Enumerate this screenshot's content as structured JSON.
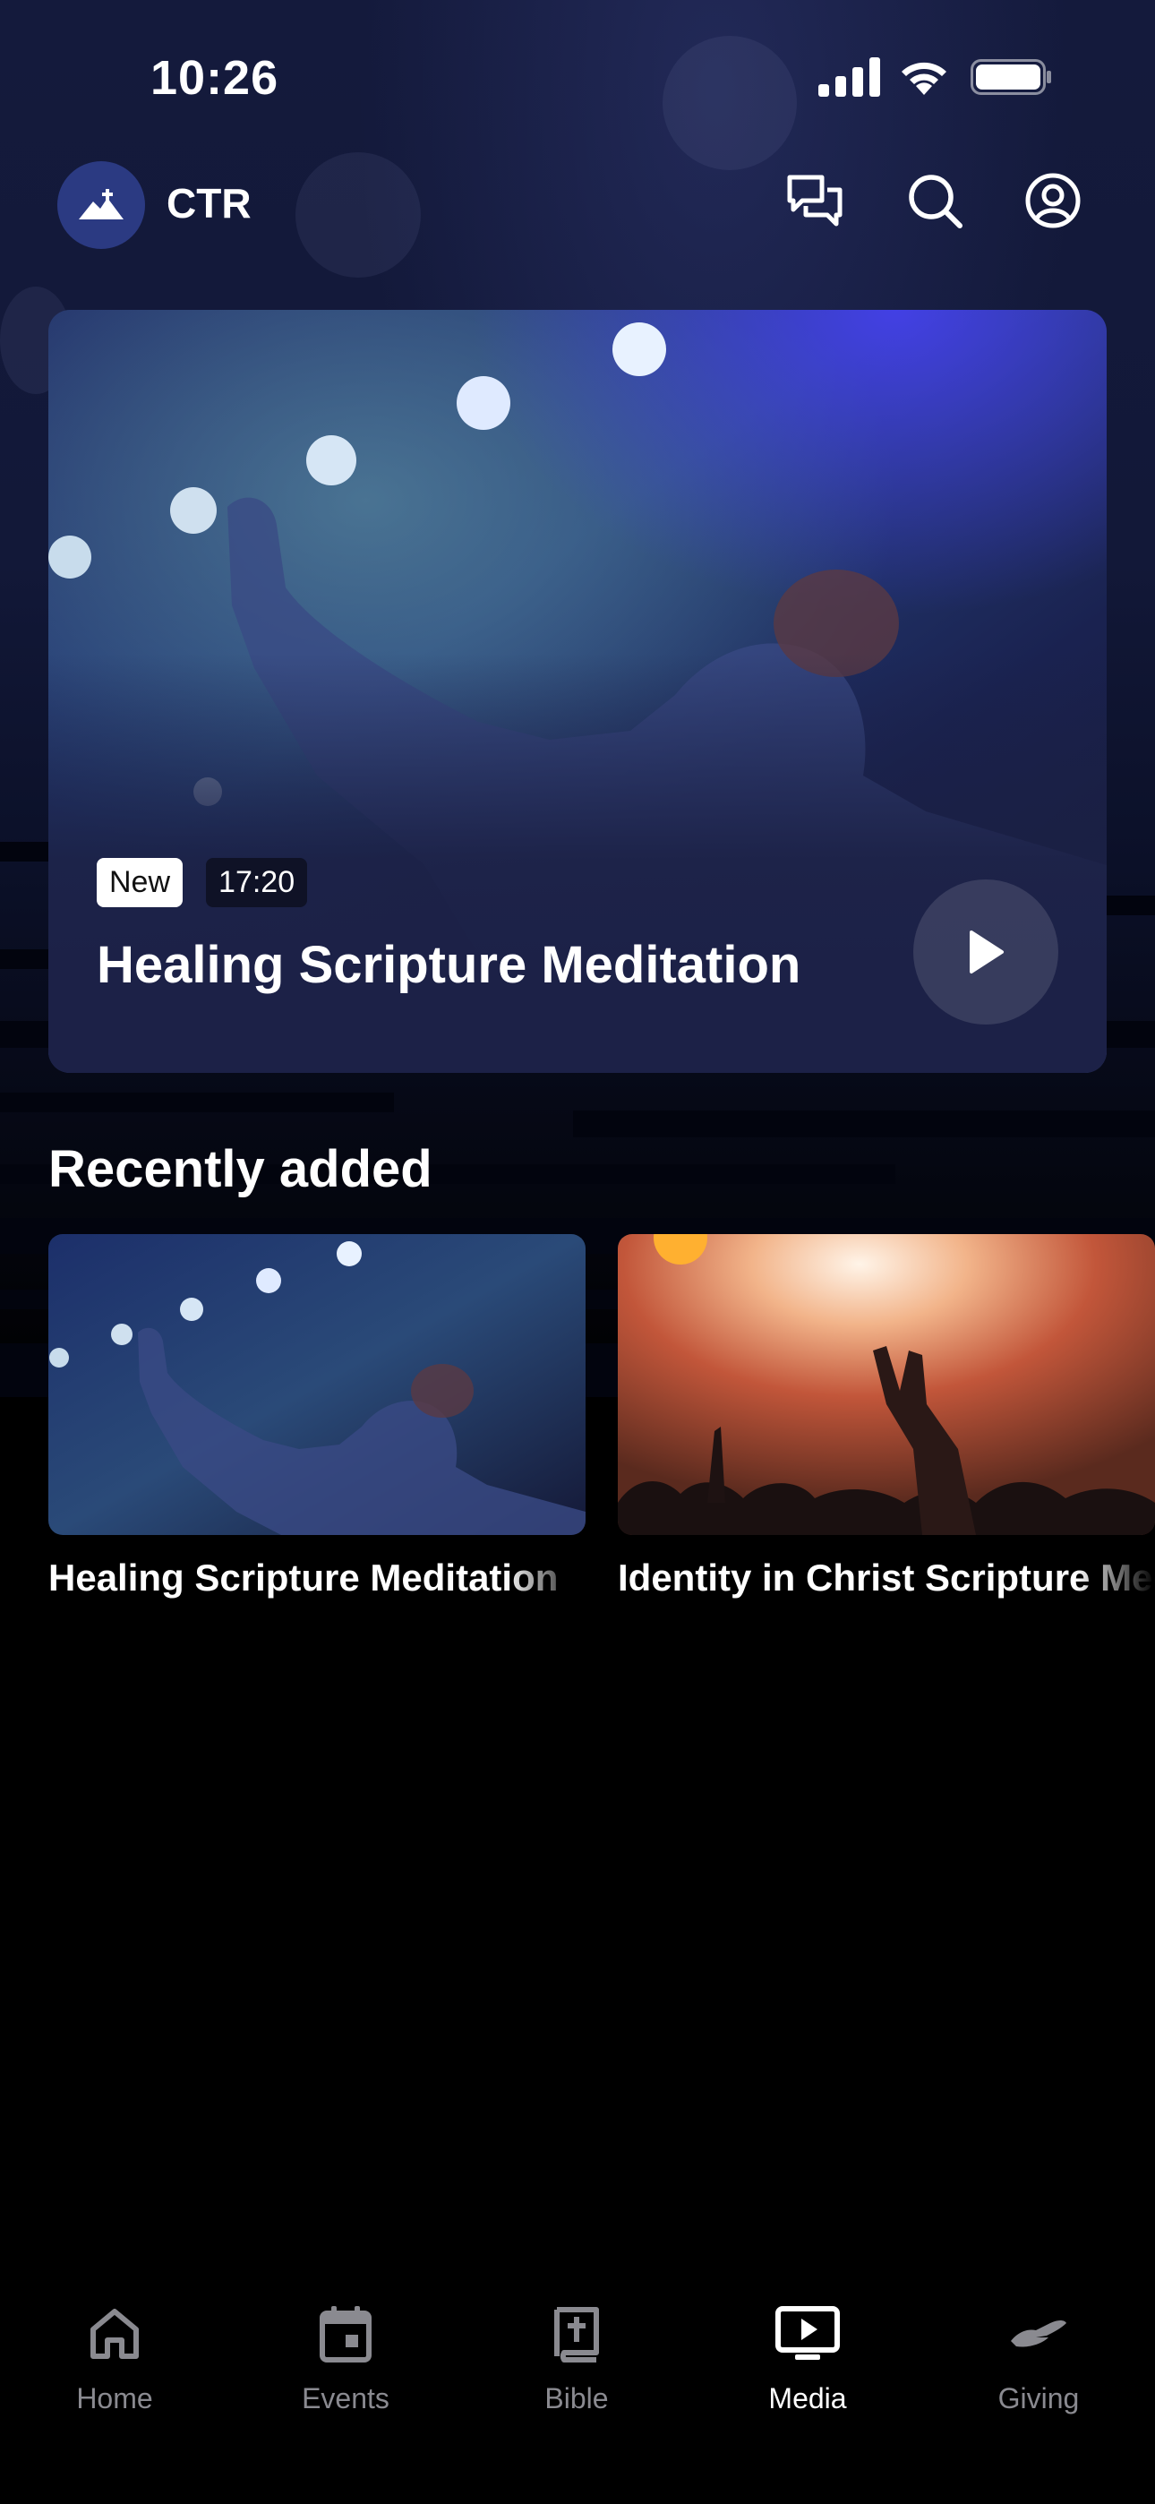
{
  "status_bar": {
    "time": "10:26"
  },
  "header": {
    "brand": "CTR"
  },
  "hero": {
    "badge_new": "New",
    "duration": "17:20",
    "title": "Healing Scripture Meditation"
  },
  "recent": {
    "title": "Recently added",
    "items": [
      {
        "title": "Healing Scripture Meditation"
      },
      {
        "title": "Identity in Christ Scripture Meditation"
      }
    ]
  },
  "tabs": [
    {
      "label": "Home",
      "icon": "home-icon"
    },
    {
      "label": "Events",
      "icon": "calendar-icon"
    },
    {
      "label": "Bible",
      "icon": "bible-icon"
    },
    {
      "label": "Media",
      "icon": "media-icon",
      "active": true
    },
    {
      "label": "Giving",
      "icon": "giving-icon"
    }
  ],
  "colors": {
    "accent": "#2b3a82",
    "card_bg": "#1b2044"
  }
}
